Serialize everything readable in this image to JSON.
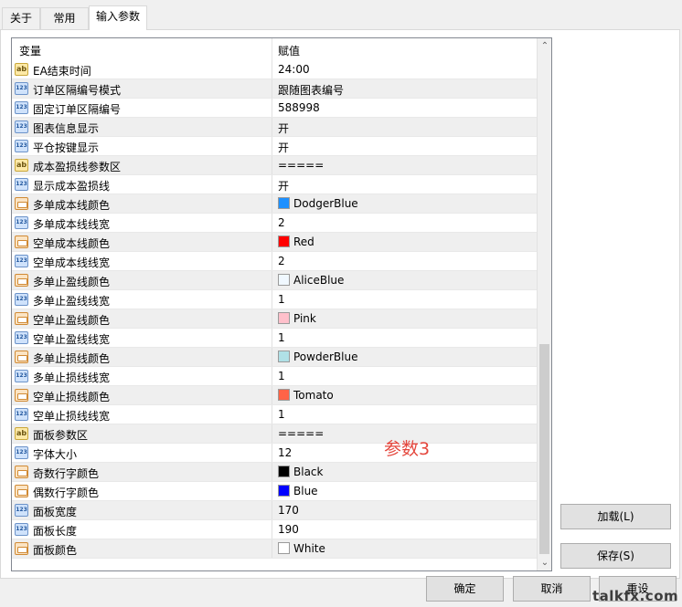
{
  "tabs": [
    {
      "label": "关于"
    },
    {
      "label": "常用"
    },
    {
      "label": "输入参数"
    }
  ],
  "grid": {
    "col_variable": "变量",
    "col_value": "赋值",
    "rows": [
      {
        "icon": "ab",
        "name": "EA结束时间",
        "value": "24:00"
      },
      {
        "icon": "123",
        "name": "订单区隔编号模式",
        "value": "跟随图表编号"
      },
      {
        "icon": "123",
        "name": "固定订单区隔编号",
        "value": "588998"
      },
      {
        "icon": "123",
        "name": "图表信息显示",
        "value": "开"
      },
      {
        "icon": "123",
        "name": "平仓按键显示",
        "value": "开"
      },
      {
        "icon": "ab",
        "name": "成本盈损线参数区",
        "value": "====="
      },
      {
        "icon": "123",
        "name": "显示成本盈损线",
        "value": "开"
      },
      {
        "icon": "color",
        "name": "多单成本线颜色",
        "value": "DodgerBlue",
        "swatch": "#1e90ff"
      },
      {
        "icon": "123",
        "name": "多单成本线线宽",
        "value": "2"
      },
      {
        "icon": "color",
        "name": "空单成本线颜色",
        "value": "Red",
        "swatch": "#ff0000"
      },
      {
        "icon": "123",
        "name": "空单成本线线宽",
        "value": "2"
      },
      {
        "icon": "color",
        "name": "多单止盈线颜色",
        "value": "AliceBlue",
        "swatch": "#f0f8ff"
      },
      {
        "icon": "123",
        "name": "多单止盈线线宽",
        "value": "1"
      },
      {
        "icon": "color",
        "name": "空单止盈线颜色",
        "value": "Pink",
        "swatch": "#ffc0cb"
      },
      {
        "icon": "123",
        "name": "空单止盈线线宽",
        "value": "1"
      },
      {
        "icon": "color",
        "name": "多单止损线颜色",
        "value": "PowderBlue",
        "swatch": "#b0e0e6"
      },
      {
        "icon": "123",
        "name": "多单止损线线宽",
        "value": "1"
      },
      {
        "icon": "color",
        "name": "空单止损线颜色",
        "value": "Tomato",
        "swatch": "#ff6347"
      },
      {
        "icon": "123",
        "name": "空单止损线线宽",
        "value": "1"
      },
      {
        "icon": "ab",
        "name": "面板参数区",
        "value": "====="
      },
      {
        "icon": "123",
        "name": "字体大小",
        "value": "12"
      },
      {
        "icon": "color",
        "name": "奇数行字颜色",
        "value": "Black",
        "swatch": "#000000"
      },
      {
        "icon": "color",
        "name": "偶数行字颜色",
        "value": "Blue",
        "swatch": "#0000ff"
      },
      {
        "icon": "123",
        "name": "面板宽度",
        "value": "170"
      },
      {
        "icon": "123",
        "name": "面板长度",
        "value": "190"
      },
      {
        "icon": "color",
        "name": "面板颜色",
        "value": "White",
        "swatch": "#ffffff"
      }
    ]
  },
  "note": "参数3",
  "buttons": {
    "load": "加载(L)",
    "save": "保存(S)",
    "ok": "确定",
    "cancel": "取消",
    "reset": "重设"
  },
  "watermark": "talkfx.com"
}
